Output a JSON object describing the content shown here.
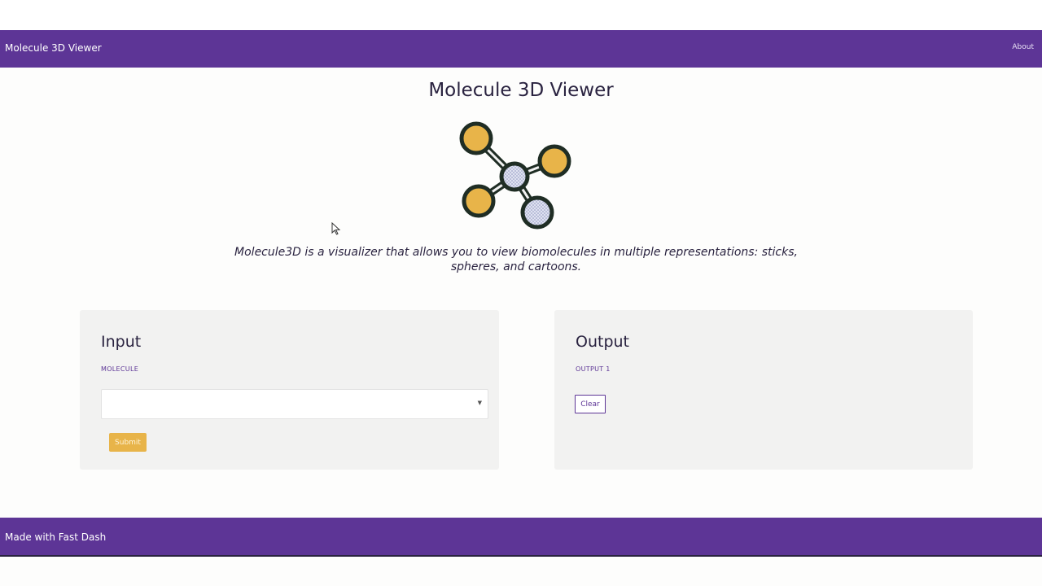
{
  "navbar": {
    "brand": "Molecule 3D Viewer",
    "about_link": "About"
  },
  "page": {
    "title": "Molecule 3D Viewer",
    "description": "Molecule3D is a visualizer that allows you to view biomolecules in multiple representations: sticks, spheres, and cartoons."
  },
  "input_card": {
    "heading": "Input",
    "field_label": "MOLECULE",
    "dropdown_value": "",
    "submit_label": "Submit"
  },
  "output_card": {
    "heading": "Output",
    "field_label": "OUTPUT 1",
    "clear_label": "Clear"
  },
  "footer": {
    "text": "Made with Fast Dash"
  },
  "icons": {
    "logo": "molecule-icon",
    "dropdown": "caret-down-icon",
    "cursor": "mouse-pointer-icon"
  },
  "colors": {
    "primary": "#5d3596",
    "accent": "#e8b449",
    "atom_orange": "#e8b449",
    "atom_center": "#d9dcef",
    "bond_outline": "#1f2d24"
  }
}
